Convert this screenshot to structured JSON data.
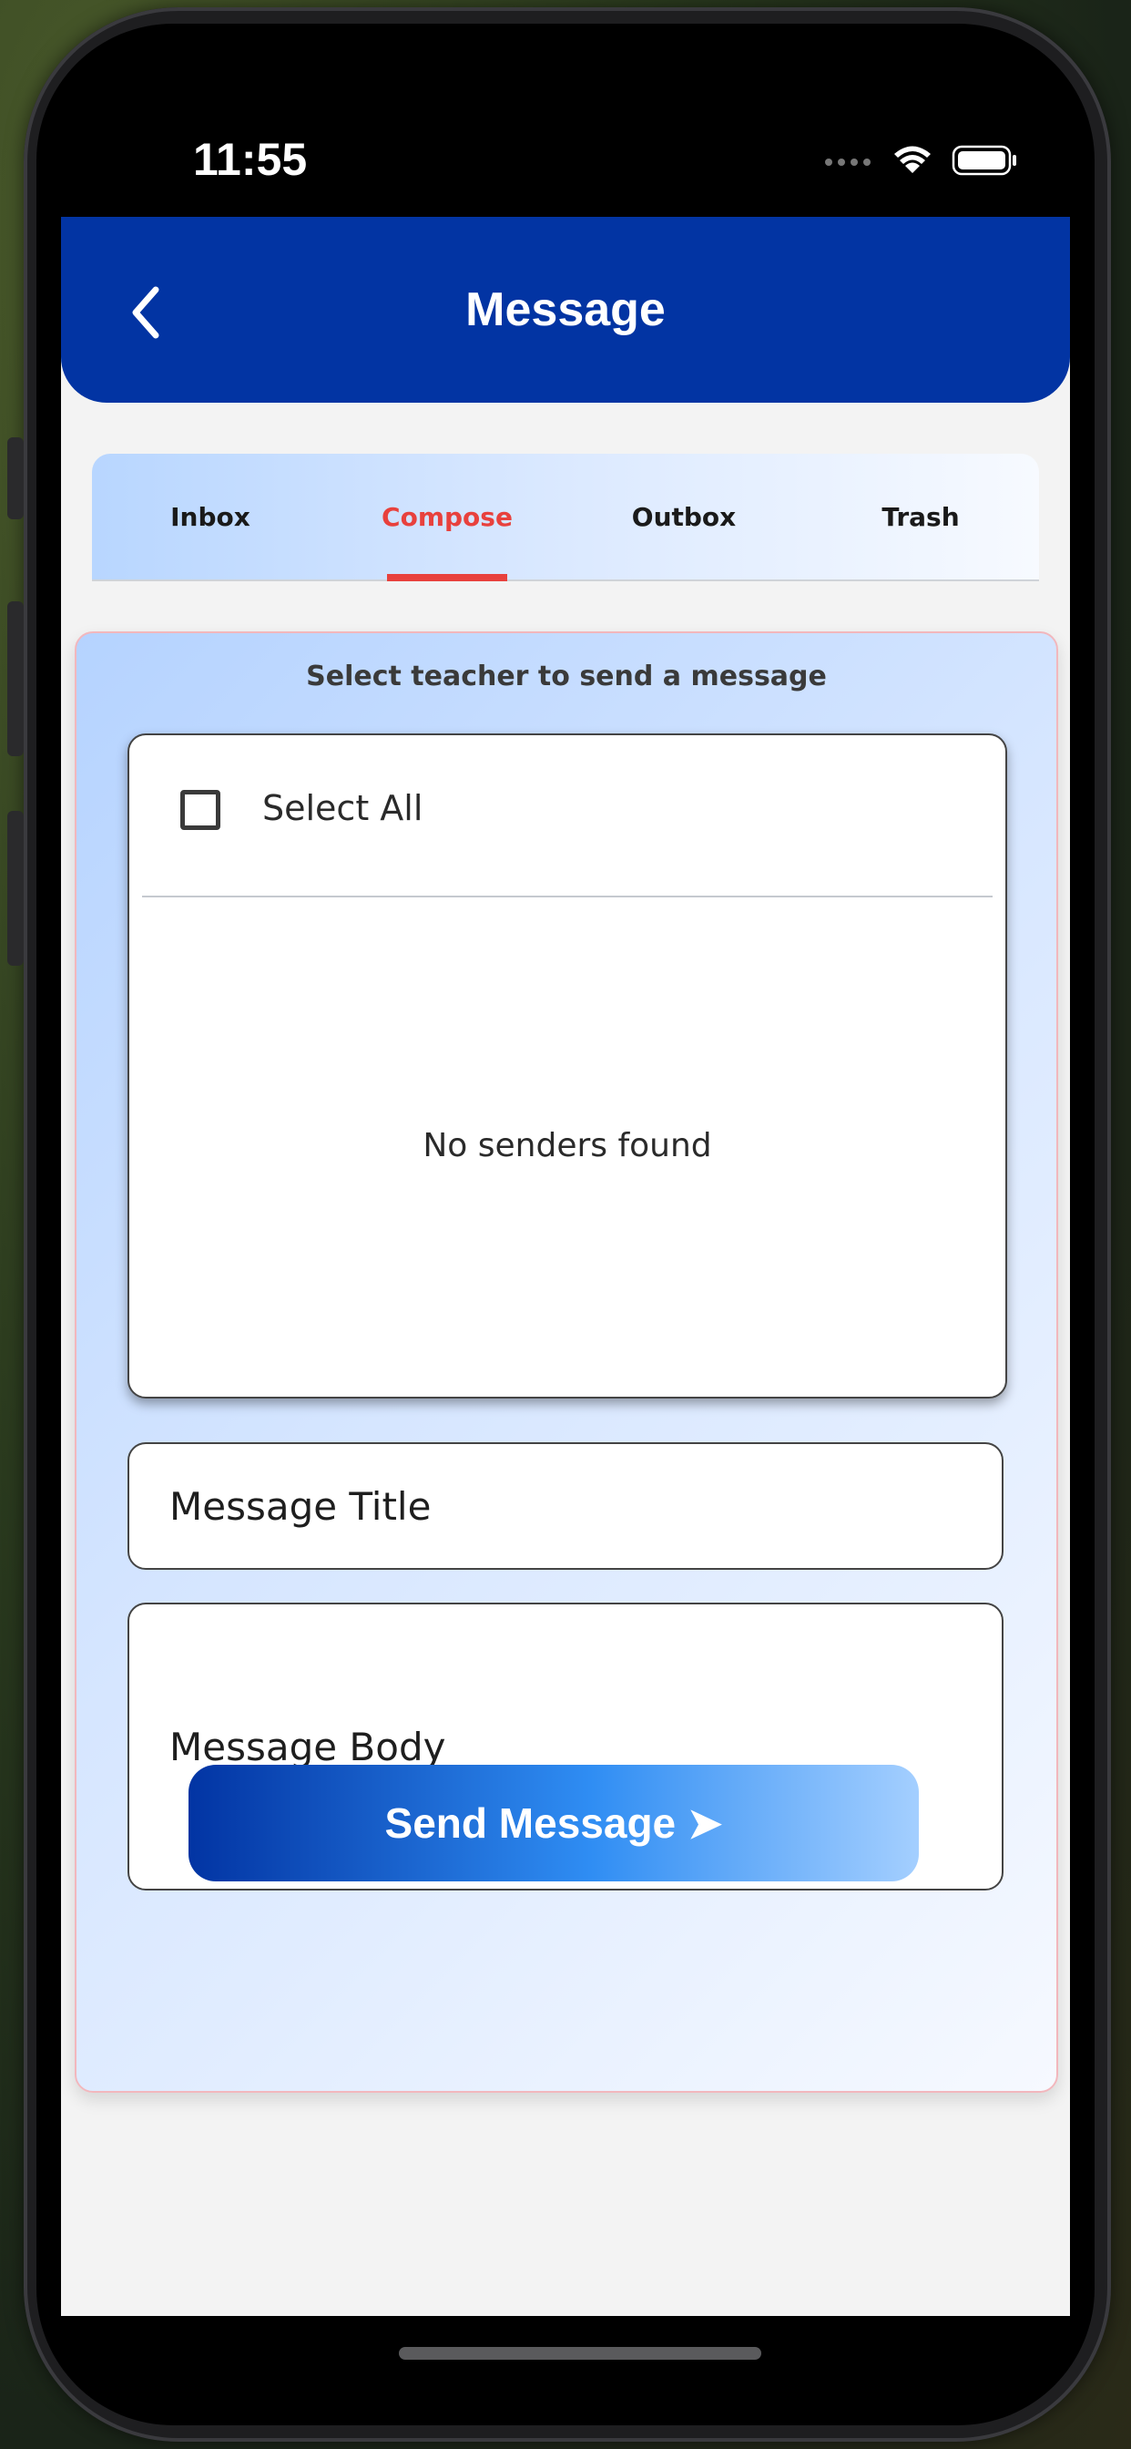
{
  "status_bar": {
    "time": "11:55"
  },
  "header": {
    "title": "Message",
    "back_icon": "chevron-left-icon"
  },
  "tabs": [
    {
      "label": "Inbox",
      "active": false
    },
    {
      "label": "Compose",
      "active": true
    },
    {
      "label": "Outbox",
      "active": false
    },
    {
      "label": "Trash",
      "active": false
    }
  ],
  "compose": {
    "heading": "Select teacher to send a message",
    "select_all_label": "Select All",
    "empty_message": "No senders found",
    "title_placeholder": "Message Title",
    "body_placeholder": "Message Body",
    "send_label": "Send Message ➤"
  },
  "colors": {
    "header": "#0234a3",
    "active_tab": "#e8413d",
    "card_border": "#f2b7bd"
  }
}
